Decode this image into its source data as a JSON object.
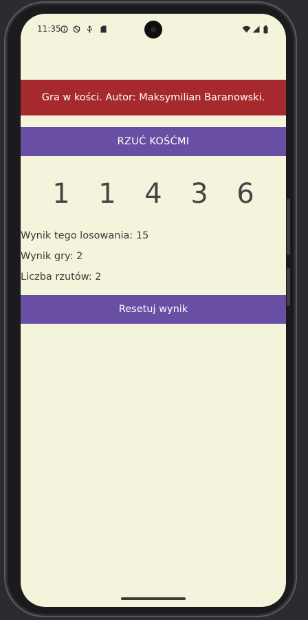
{
  "status_bar": {
    "time": "11:35",
    "left_icons": [
      "info-icon",
      "shield-icon",
      "usb-icon",
      "sd-card-icon"
    ],
    "right_icons": [
      "wifi-icon",
      "signal-icon",
      "battery-icon"
    ]
  },
  "app": {
    "header": "Gra w kości. Autor: Maksymilian Baranowski.",
    "roll_button": "RZUĆ KOŚĆMI",
    "dice": [
      "1",
      "1",
      "4",
      "3",
      "6"
    ],
    "round_score": "Wynik tego losowania: 15",
    "game_score": "Wynik gry: 2",
    "roll_count": "Liczba rzutów: 2",
    "reset_button": "Resetuj wynik"
  },
  "colors": {
    "background": "#f4f4dc",
    "header": "#a62a2d",
    "button": "#684fa3"
  }
}
